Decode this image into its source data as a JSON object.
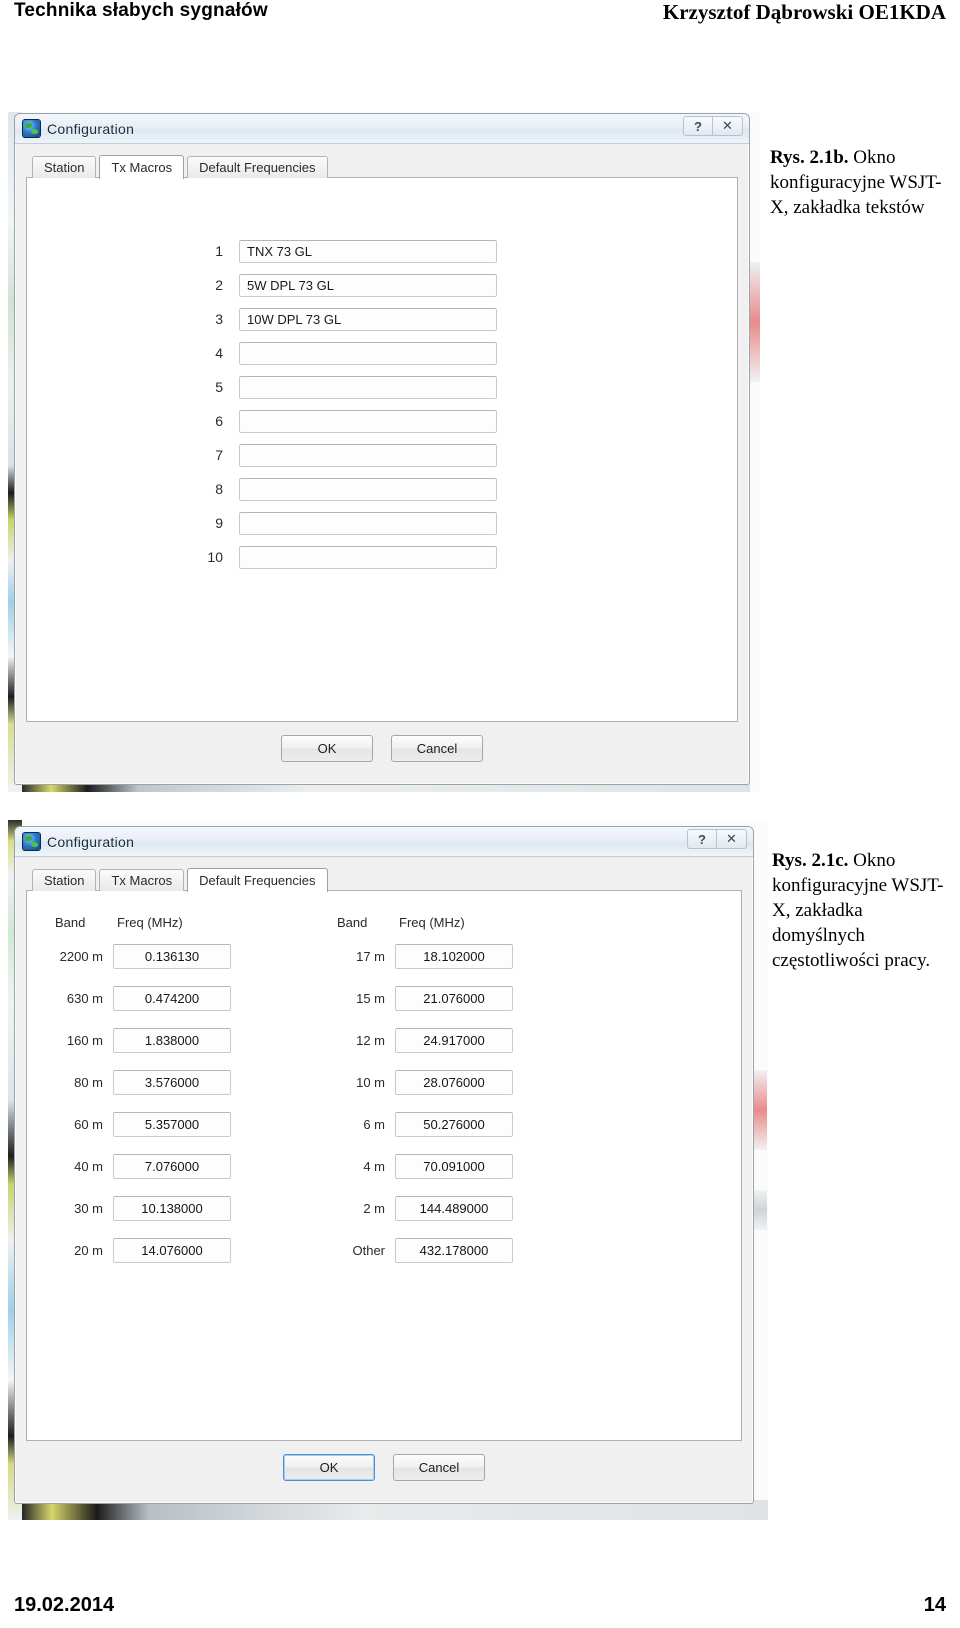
{
  "page": {
    "header_left": "Technika słabych sygnałów",
    "header_right": "Krzysztof Dąbrowski OE1KDA",
    "footer_date": "19.02.2014",
    "footer_page": "14"
  },
  "dialog1": {
    "title": "Configuration",
    "icon": "globe-icon",
    "help_button": "?",
    "close_button": "✕",
    "tabs": [
      {
        "label": "Station",
        "active": false
      },
      {
        "label": "Tx Macros",
        "active": true
      },
      {
        "label": "Default Frequencies",
        "active": false
      }
    ],
    "macros": [
      {
        "num": "1",
        "value": "TNX 73 GL"
      },
      {
        "num": "2",
        "value": "5W DPL 73 GL"
      },
      {
        "num": "3",
        "value": "10W DPL 73 GL"
      },
      {
        "num": "4",
        "value": ""
      },
      {
        "num": "5",
        "value": ""
      },
      {
        "num": "6",
        "value": ""
      },
      {
        "num": "7",
        "value": ""
      },
      {
        "num": "8",
        "value": ""
      },
      {
        "num": "9",
        "value": ""
      },
      {
        "num": "10",
        "value": ""
      }
    ],
    "ok_label": "OK",
    "cancel_label": "Cancel"
  },
  "dialog2": {
    "title": "Configuration",
    "icon": "globe-icon",
    "help_button": "?",
    "close_button": "✕",
    "tabs": [
      {
        "label": "Station",
        "active": false
      },
      {
        "label": "Tx Macros",
        "active": false
      },
      {
        "label": "Default Frequencies",
        "active": true
      }
    ],
    "columns": {
      "band_header": "Band",
      "freq_header": "Freq (MHz)"
    },
    "frequencies_left": [
      {
        "band": "2200 m",
        "freq": "0.136130"
      },
      {
        "band": "630 m",
        "freq": "0.474200"
      },
      {
        "band": "160 m",
        "freq": "1.838000"
      },
      {
        "band": "80 m",
        "freq": "3.576000"
      },
      {
        "band": "60 m",
        "freq": "5.357000"
      },
      {
        "band": "40 m",
        "freq": "7.076000"
      },
      {
        "band": "30 m",
        "freq": "10.138000"
      },
      {
        "band": "20 m",
        "freq": "14.076000"
      }
    ],
    "frequencies_right": [
      {
        "band": "17 m",
        "freq": "18.102000"
      },
      {
        "band": "15 m",
        "freq": "21.076000"
      },
      {
        "band": "12 m",
        "freq": "24.917000"
      },
      {
        "band": "10 m",
        "freq": "28.076000"
      },
      {
        "band": "6 m",
        "freq": "50.276000"
      },
      {
        "band": "4 m",
        "freq": "70.091000"
      },
      {
        "band": "2 m",
        "freq": "144.489000"
      },
      {
        "band": "Other",
        "freq": "432.178000"
      }
    ],
    "ok_label": "OK",
    "cancel_label": "Cancel"
  },
  "caption1": {
    "ref": "Rys. 2.1b.",
    "text": " Okno konfiguracyjne WSJT-X, zakładka tekstów"
  },
  "caption2": {
    "ref": "Rys. 2.1c.",
    "text": " Okno konfiguracyjne WSJT-X, zakładka domyślnych częstotliwości pracy."
  }
}
